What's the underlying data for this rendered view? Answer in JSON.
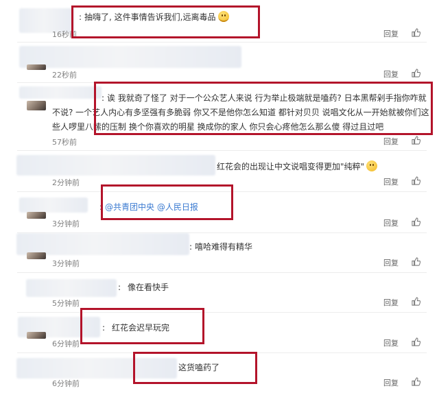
{
  "actions": {
    "reply_label": "回复",
    "like_icon": "thumbs-up-icon"
  },
  "comments": [
    {
      "time": "16秒前",
      "text": "抽嗨了, 这件事情告诉我们,远离毒品",
      "emoji": "smile-emoji"
    },
    {
      "time": "22秒前",
      "text": ""
    },
    {
      "time": "57秒前",
      "text": "诶 我就奇了怪了 对于一个公众艺人来说 行为举止极端就是嗑药? 日本黑帮剁手指你咋就不说? 一个艺人内心有多坚强有多脆弱 你又不是他你怎么知道 都针对贝贝 说唱文化从一开始就被你们这些人啰里八嗦的压制 换个你喜欢的明星 换成你的家人 你只会心疼他怎么那么傻 得过且过吧"
    },
    {
      "time": "2分钟前",
      "text": "红花会的出现让中文说唱变得更加\"纯粹\"",
      "emoji": "laugh-emoji"
    },
    {
      "time": "3分钟前",
      "mentions": [
        "@共青团中央",
        "@人民日报"
      ]
    },
    {
      "time": "3分钟前",
      "text": "嘻哈难得有精华"
    },
    {
      "time": "5分钟前",
      "text": "像在看快手"
    },
    {
      "time": "6分钟前",
      "text": "红花会迟早玩完"
    },
    {
      "time": "6分钟前",
      "text": "这货嗑药了"
    }
  ],
  "highlight_color": "#b3132a",
  "mention_color": "#3a7ad1"
}
